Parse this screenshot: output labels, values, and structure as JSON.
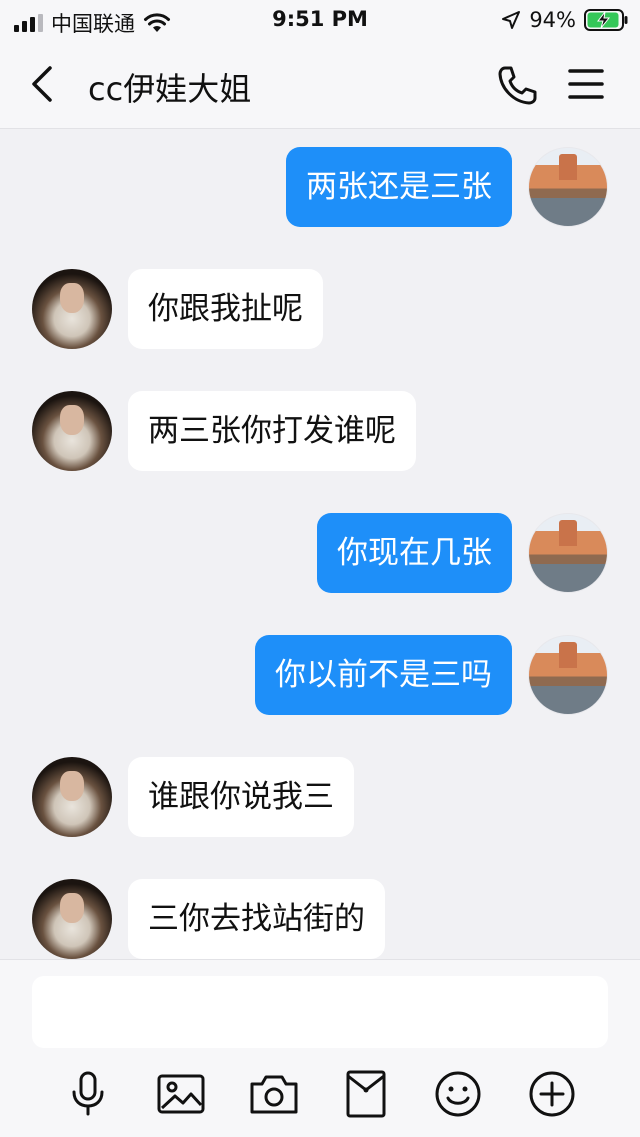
{
  "status_bar": {
    "carrier": "中国联通",
    "time": "9:51 PM",
    "battery_percent": "94%",
    "signal_bars_filled": 3,
    "signal_bars_total": 4
  },
  "header": {
    "title": "cc伊娃大姐",
    "back_icon": "chevron-left-icon",
    "call_icon": "phone-icon",
    "menu_icon": "hamburger-menu-icon"
  },
  "messages": [
    {
      "side": "out",
      "text": "两张还是三张"
    },
    {
      "side": "in",
      "text": "你跟我扯呢"
    },
    {
      "side": "in",
      "text": "两三张你打发谁呢"
    },
    {
      "side": "out",
      "text": "你现在几张"
    },
    {
      "side": "out",
      "text": "你以前不是三吗"
    },
    {
      "side": "in",
      "text": "谁跟你说我三"
    },
    {
      "side": "in",
      "text": "三你去找站街的"
    }
  ],
  "composer": {
    "input_value": "",
    "tools": [
      "microphone-icon",
      "image-icon",
      "camera-icon",
      "red-packet-icon",
      "emoji-icon",
      "plus-icon"
    ]
  },
  "colors": {
    "outgoing_bubble": "#1e8ff9",
    "incoming_bubble": "#ffffff",
    "background": "#f1f1f4",
    "battery_charging": "#34c759"
  }
}
